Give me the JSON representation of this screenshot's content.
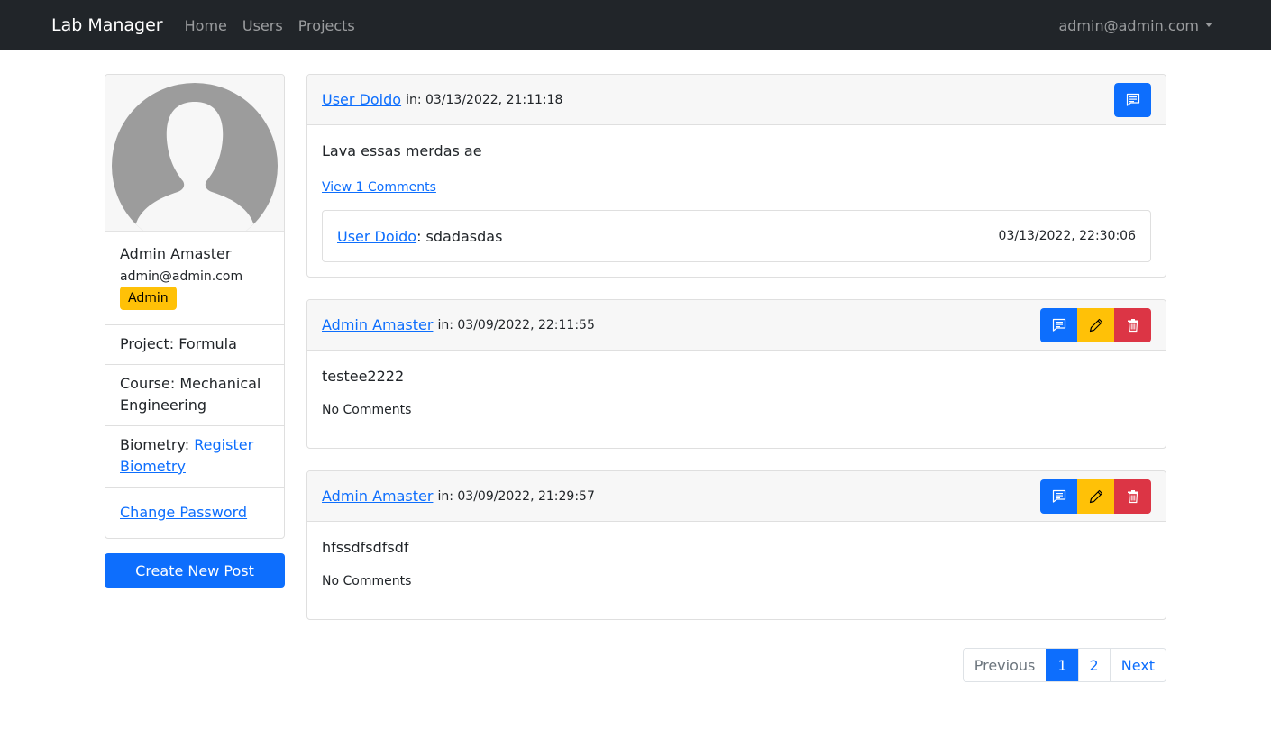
{
  "navbar": {
    "brand": "Lab Manager",
    "links": [
      {
        "label": "Home"
      },
      {
        "label": "Users"
      },
      {
        "label": "Projects"
      }
    ],
    "user_menu": "admin@admin.com"
  },
  "profile": {
    "avatar_icon": "user-silhouette-icon",
    "name": "Admin Amaster",
    "email": "admin@admin.com",
    "role_badge": "Admin",
    "project_label": "Project:",
    "project_value": "Formula",
    "course_label": "Course:",
    "course_value": "Mechanical Engineering",
    "biometry_label": "Biometry:",
    "biometry_link": "Register Biometry",
    "change_password": "Change Password",
    "create_post": "Create New Post"
  },
  "posts": [
    {
      "author": "User Doido",
      "date": "in: 03/13/2022, 21:11:18",
      "text": "Lava essas merdas ae",
      "comments_link": "View 1 Comments",
      "actions": [
        "comment"
      ],
      "comments": [
        {
          "author": "User Doido",
          "text": ": sdadasdas",
          "date": "03/13/2022, 22:30:06"
        }
      ]
    },
    {
      "author": "Admin Amaster",
      "date": "in: 03/09/2022, 22:11:55",
      "text": "testee2222",
      "comments_status": "No Comments",
      "actions": [
        "comment",
        "edit",
        "delete"
      ]
    },
    {
      "author": "Admin Amaster",
      "date": "in: 03/09/2022, 21:29:57",
      "text": "hfssdfsdfsdf",
      "comments_status": "No Comments",
      "actions": [
        "comment",
        "edit",
        "delete"
      ]
    }
  ],
  "pagination": {
    "previous": "Previous",
    "pages": [
      "1",
      "2"
    ],
    "current": "1",
    "next": "Next"
  },
  "colors": {
    "primary": "#0d6efd",
    "warning": "#ffc107",
    "danger": "#dc3545",
    "navbar": "#212529"
  }
}
